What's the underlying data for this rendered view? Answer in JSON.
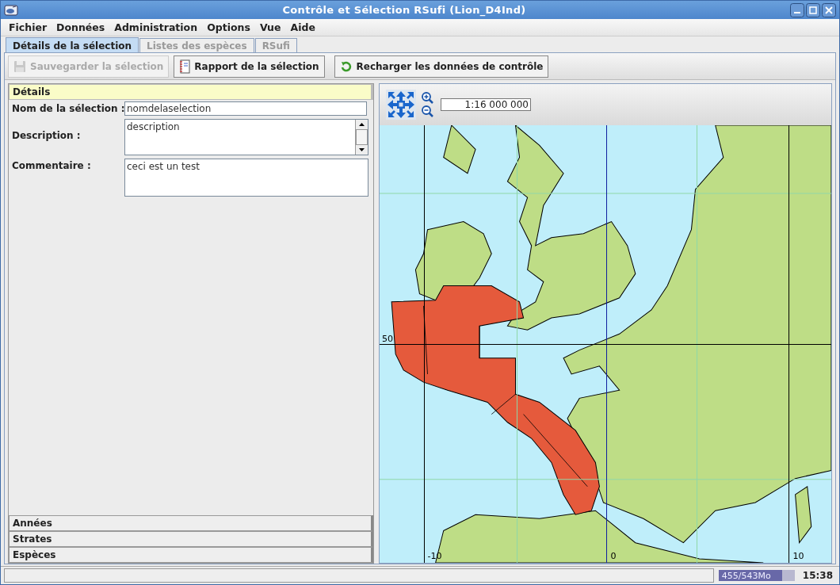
{
  "window": {
    "title": "Contrôle et Sélection RSufi (Lion_D4Ind)"
  },
  "menu": [
    "Fichier",
    "Données",
    "Administration",
    "Options",
    "Vue",
    "Aide"
  ],
  "tabs": [
    {
      "label": "Détails de la sélection",
      "selected": true
    },
    {
      "label": "Listes des espèces",
      "selected": false
    },
    {
      "label": "RSufi",
      "selected": false
    }
  ],
  "toolbar": [
    {
      "label": "Sauvegarder la sélection",
      "kind": "save",
      "disabled": true
    },
    {
      "label": "Rapport de la sélection",
      "kind": "report",
      "disabled": false
    },
    {
      "label": "Recharger les données de contrôle",
      "kind": "reload",
      "disabled": false
    }
  ],
  "sections": [
    {
      "title": "Détails",
      "expanded": true
    },
    {
      "title": "Années",
      "expanded": false
    },
    {
      "title": "Strates",
      "expanded": false
    },
    {
      "title": "Espèces",
      "expanded": false
    }
  ],
  "form": {
    "name_label": "Nom de la sélection :",
    "name_value": "nomdelaselection",
    "description_label": "Description :",
    "description_value": "description",
    "comment_label": "Commentaire :",
    "comment_value": "ceci est un test"
  },
  "map": {
    "scale": "1:16 000 000",
    "lat_label": "50",
    "lon_labels": [
      "-10",
      "0",
      "10"
    ]
  },
  "status_bar": {
    "memory": "455/543Mo",
    "level": 0.84,
    "time": "15:38"
  }
}
